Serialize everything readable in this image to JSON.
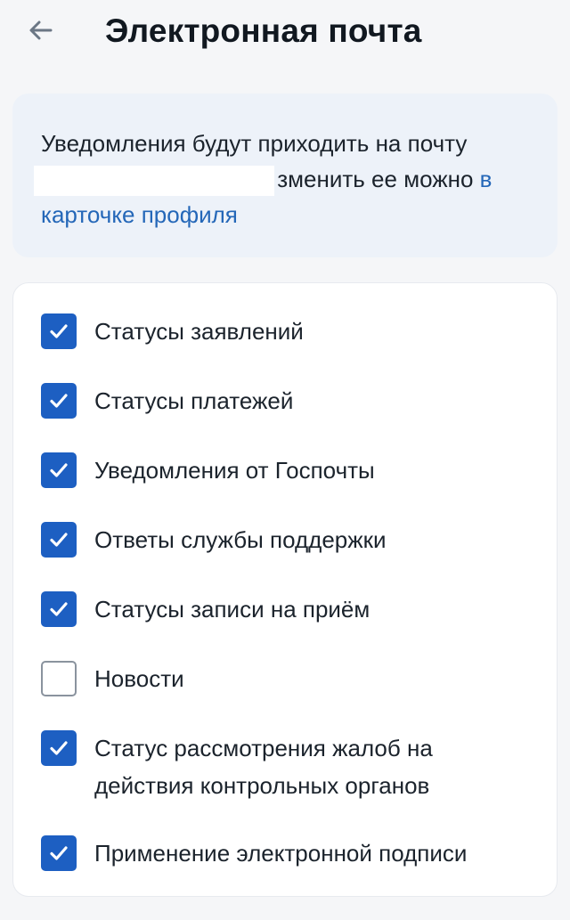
{
  "header": {
    "title": "Электронная почта",
    "back_icon": "arrow-left-icon"
  },
  "info": {
    "text_before": "Уведомления будут приходить на почту",
    "text_after": "зменить ее можно ",
    "link": "в карточке профиля"
  },
  "options": [
    {
      "label": "Статусы заявлений",
      "checked": true
    },
    {
      "label": "Статусы платежей",
      "checked": true
    },
    {
      "label": "Уведомления от Госпочты",
      "checked": true
    },
    {
      "label": "Ответы службы поддержки",
      "checked": true
    },
    {
      "label": "Статусы записи на приём",
      "checked": true
    },
    {
      "label": "Новости",
      "checked": false
    },
    {
      "label": "Статус рассмотрения жалоб на действия контрольных органов",
      "checked": true
    },
    {
      "label": "Применение электронной подписи",
      "checked": true
    }
  ],
  "colors": {
    "accent": "#1d5fc2",
    "link": "#2467b8",
    "info_background": "#edf2f9"
  }
}
